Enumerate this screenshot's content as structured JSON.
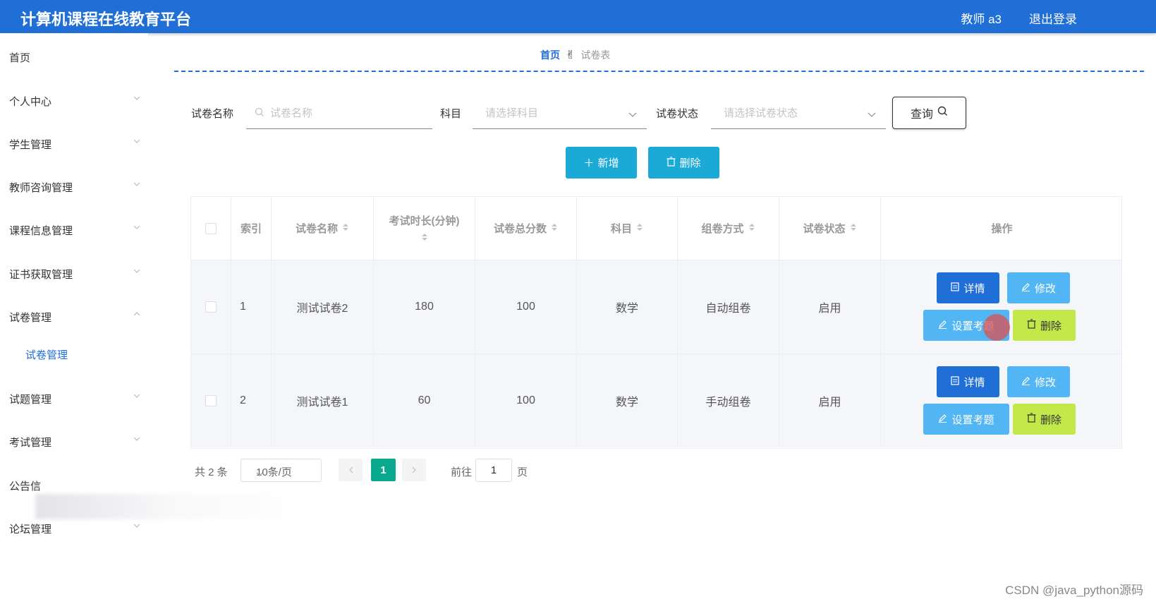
{
  "header": {
    "title": "计算机课程在线教育平台",
    "user": "教师 a3",
    "logout": "退出登录"
  },
  "sidebar": {
    "items": [
      {
        "label": "首页"
      },
      {
        "label": "个人中心"
      },
      {
        "label": "学生管理"
      },
      {
        "label": "教师咨询管理"
      },
      {
        "label": "课程信息管理"
      },
      {
        "label": "证书获取管理"
      },
      {
        "label": "试卷管理"
      },
      {
        "label": "试题管理"
      },
      {
        "label": "考试管理"
      },
      {
        "label": "公告信"
      },
      {
        "label": "论坛管理"
      }
    ],
    "submenu_item": "试卷管理"
  },
  "breadcrumb": {
    "home": "首页",
    "current": "试卷表"
  },
  "search": {
    "name_label": "试卷名称",
    "name_placeholder": "试卷名称",
    "subject_label": "科目",
    "subject_placeholder": "请选择科目",
    "status_label": "试卷状态",
    "status_placeholder": "请选择试卷状态",
    "query_label": "查询"
  },
  "actions": {
    "add_label": "新增",
    "delete_label": "删除"
  },
  "table": {
    "headers": {
      "index": "索引",
      "name": "试卷名称",
      "duration": "考试时长(分钟)",
      "total": "试卷总分数",
      "subject": "科目",
      "method": "组卷方式",
      "status": "试卷状态",
      "ops": "操作"
    },
    "rows": [
      {
        "index": "1",
        "name": "测试试卷2",
        "duration": "180",
        "total": "100",
        "subject": "数学",
        "method": "自动组卷",
        "status": "启用"
      },
      {
        "index": "2",
        "name": "测试试卷1",
        "duration": "60",
        "total": "100",
        "subject": "数学",
        "method": "手动组卷",
        "status": "启用"
      }
    ],
    "op_labels": {
      "detail": "详情",
      "edit": "修改",
      "set_questions": "设置考题",
      "delete": "删除"
    }
  },
  "pagination": {
    "total_text": "共 2 条",
    "page_size": "10条/页",
    "current_page": "1",
    "goto_label": "前往",
    "goto_value": "1",
    "page_suffix": "页"
  },
  "watermark": "CSDN @java_python源码",
  "colors": {
    "primary": "#1f6fd6",
    "add_button": "#1ba9d6",
    "edit_button": "#52b6f5",
    "delete_button": "#c3e84a",
    "current_page": "#0aa88f"
  }
}
